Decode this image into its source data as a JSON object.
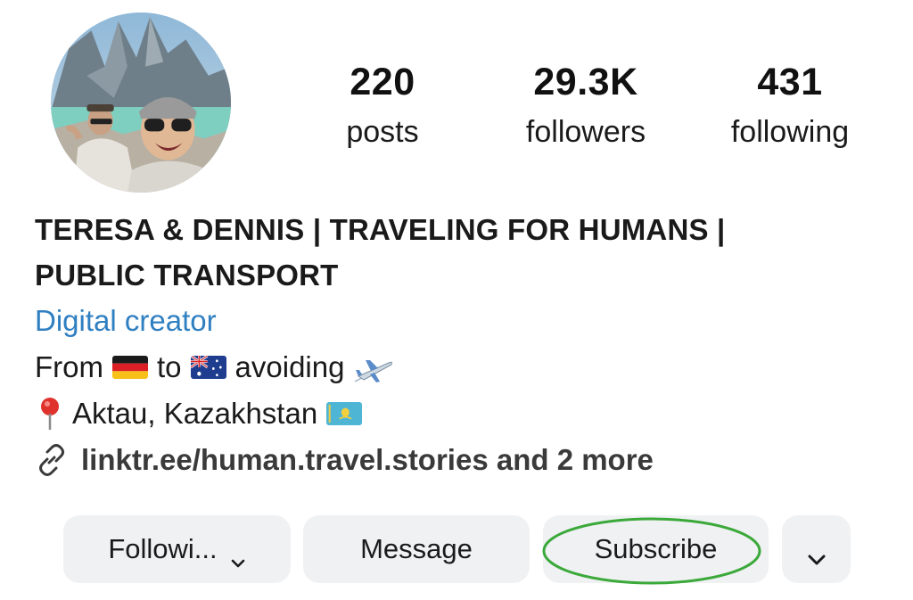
{
  "profile": {
    "avatar_icon": "profile-photo",
    "stats": {
      "posts": {
        "value": "220",
        "label": "posts"
      },
      "followers": {
        "value": "29.3K",
        "label": "followers"
      },
      "following": {
        "value": "431",
        "label": "following"
      }
    },
    "name_line1": "TERESA & DENNIS | TRAVELING FOR HUMANS |",
    "name_line2": "PUBLIC TRANSPORT",
    "category": "Digital creator",
    "bio": {
      "from_text": "From",
      "to_text": "to",
      "avoiding_text": "avoiding",
      "location": "Aktau, Kazakhstan",
      "link": "linktr.ee/human.travel.stories and 2 more"
    }
  },
  "actions": {
    "following_label": "Followi...",
    "message_label": "Message",
    "subscribe_label": "Subscribe"
  },
  "colors": {
    "accent_link": "#2f7fc1",
    "button_bg": "#f0f1f3",
    "highlight_ring": "#3aa93a"
  }
}
